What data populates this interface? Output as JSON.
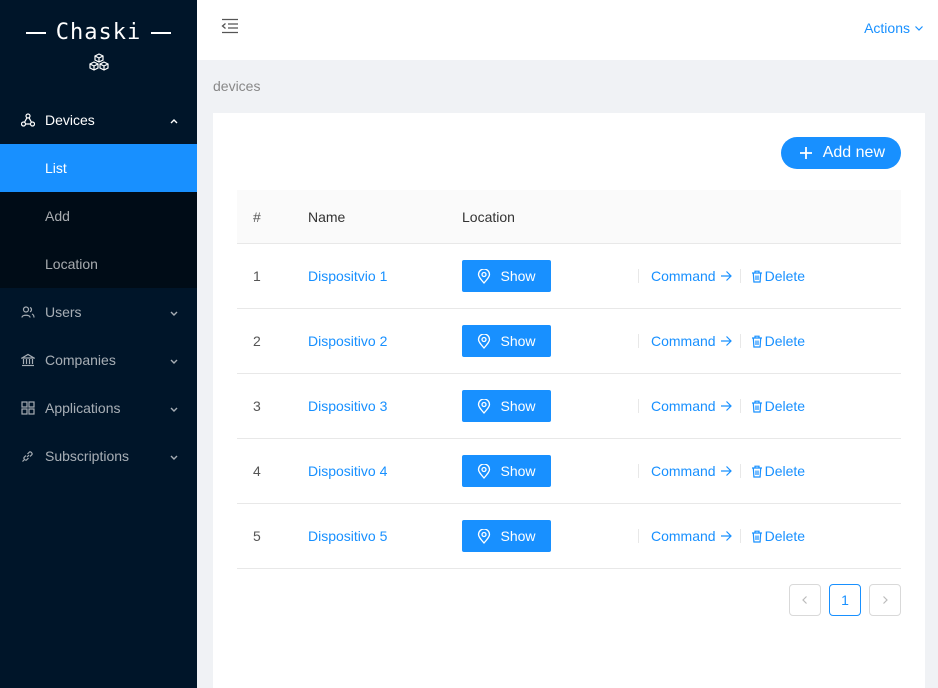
{
  "app": {
    "brand": "Chaski"
  },
  "sidebar": {
    "devices": {
      "label": "Devices",
      "sub": [
        {
          "label": "List"
        },
        {
          "label": "Add"
        },
        {
          "label": "Location"
        }
      ]
    },
    "items": [
      {
        "label": "Users"
      },
      {
        "label": "Companies"
      },
      {
        "label": "Applications"
      },
      {
        "label": "Subscriptions"
      }
    ]
  },
  "header": {
    "actions_label": "Actions"
  },
  "breadcrumb": "devices",
  "toolbar": {
    "add_label": "Add new"
  },
  "table": {
    "columns": [
      "#",
      "Name",
      "Location"
    ],
    "rows": [
      {
        "num": "1",
        "name": "Dispositvio 1",
        "show": "Show",
        "command": "Command",
        "delete": "Delete"
      },
      {
        "num": "2",
        "name": "Dispositivo 2",
        "show": "Show",
        "command": "Command",
        "delete": "Delete"
      },
      {
        "num": "3",
        "name": "Dispositivo 3",
        "show": "Show",
        "command": "Command",
        "delete": "Delete"
      },
      {
        "num": "4",
        "name": "Dispositivo 4",
        "show": "Show",
        "command": "Command",
        "delete": "Delete"
      },
      {
        "num": "5",
        "name": "Dispositivo 5",
        "show": "Show",
        "command": "Command",
        "delete": "Delete"
      }
    ]
  },
  "pagination": {
    "current": "1"
  },
  "colors": {
    "primary": "#1890ff",
    "sidebar_bg": "#001529",
    "submenu_bg": "#000c17"
  }
}
